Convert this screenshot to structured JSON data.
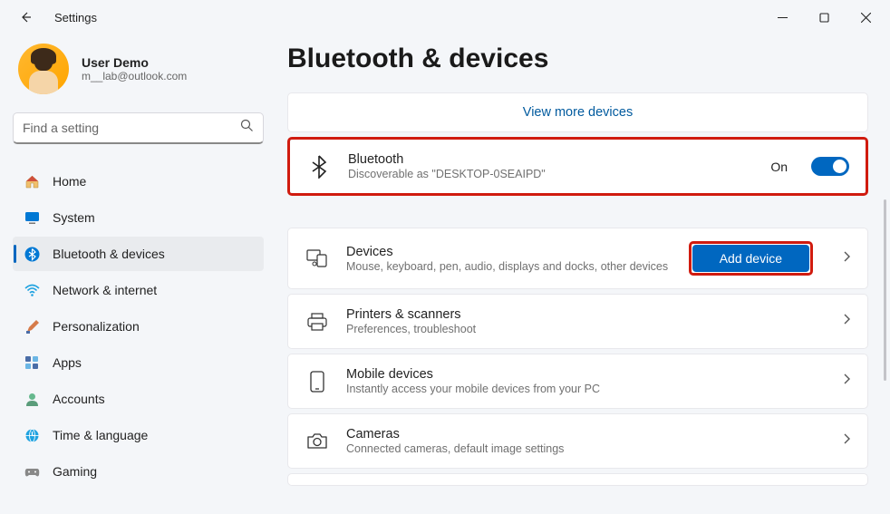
{
  "window": {
    "title": "Settings"
  },
  "user": {
    "name": "User Demo",
    "email": "m__lab@outlook.com"
  },
  "search": {
    "placeholder": "Find a setting"
  },
  "nav": {
    "home": "Home",
    "system": "System",
    "bluetooth": "Bluetooth & devices",
    "network": "Network & internet",
    "personalization": "Personalization",
    "apps": "Apps",
    "accounts": "Accounts",
    "time": "Time & language",
    "gaming": "Gaming"
  },
  "page": {
    "title": "Bluetooth & devices"
  },
  "viewMore": "View more devices",
  "bluetooth": {
    "title": "Bluetooth",
    "subtitle": "Discoverable as \"DESKTOP-0SEAIPD\"",
    "state": "On"
  },
  "devices": {
    "title": "Devices",
    "subtitle": "Mouse, keyboard, pen, audio, displays and docks, other devices",
    "button": "Add device"
  },
  "printers": {
    "title": "Printers & scanners",
    "subtitle": "Preferences, troubleshoot"
  },
  "mobile": {
    "title": "Mobile devices",
    "subtitle": "Instantly access your mobile devices from your PC"
  },
  "cameras": {
    "title": "Cameras",
    "subtitle": "Connected cameras, default image settings"
  }
}
